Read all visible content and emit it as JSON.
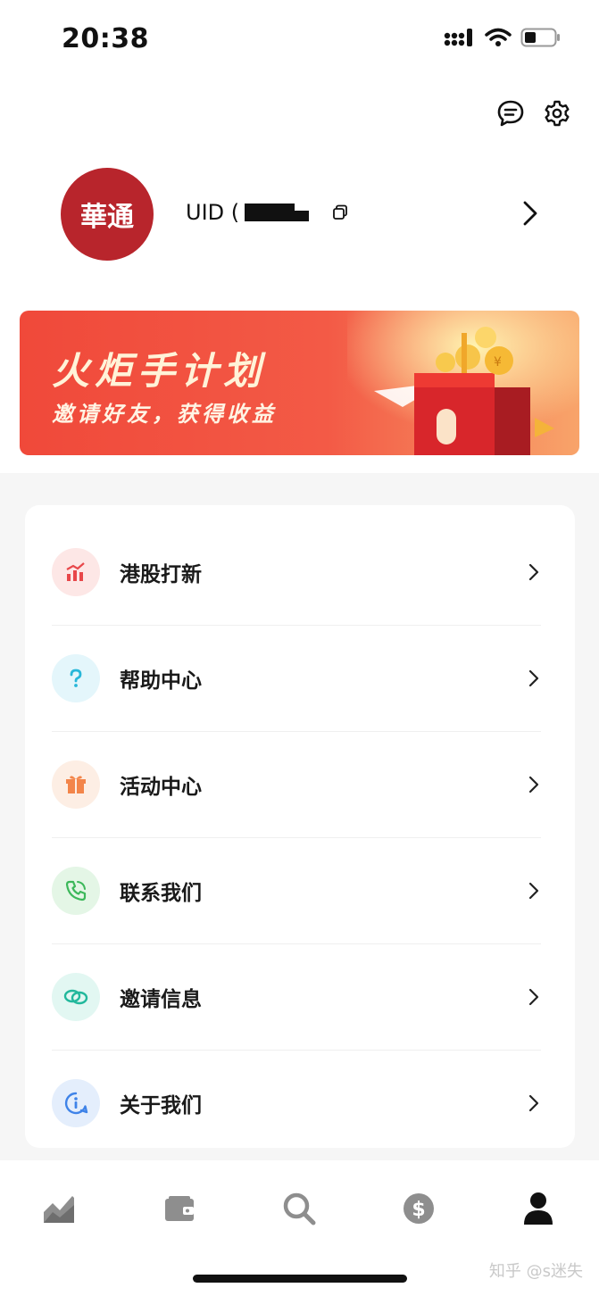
{
  "status_bar": {
    "time": "20:38"
  },
  "profile": {
    "avatar_text": "華通",
    "uid_label": "UID (",
    "uid_value_hidden": true
  },
  "banner": {
    "title": "火炬手计划",
    "subtitle": "邀请好友，获得收益"
  },
  "menu": {
    "items": [
      {
        "label": "港股打新",
        "icon": "ipo-chart-icon"
      },
      {
        "label": "帮助中心",
        "icon": "question-icon"
      },
      {
        "label": "活动中心",
        "icon": "gift-icon"
      },
      {
        "label": "联系我们",
        "icon": "phone-icon"
      },
      {
        "label": "邀请信息",
        "icon": "invite-link-icon"
      },
      {
        "label": "关于我们",
        "icon": "info-icon"
      }
    ]
  },
  "bottom_nav": {
    "items": [
      {
        "icon": "market-chart-icon"
      },
      {
        "icon": "wallet-icon"
      },
      {
        "icon": "search-icon"
      },
      {
        "icon": "dollar-icon"
      },
      {
        "icon": "profile-icon",
        "active": true
      }
    ]
  },
  "watermark": "知乎 @s迷失",
  "colors": {
    "brand_red": "#b8252c",
    "banner_red": "#f0493a",
    "text_dark": "#1a1a1a"
  }
}
